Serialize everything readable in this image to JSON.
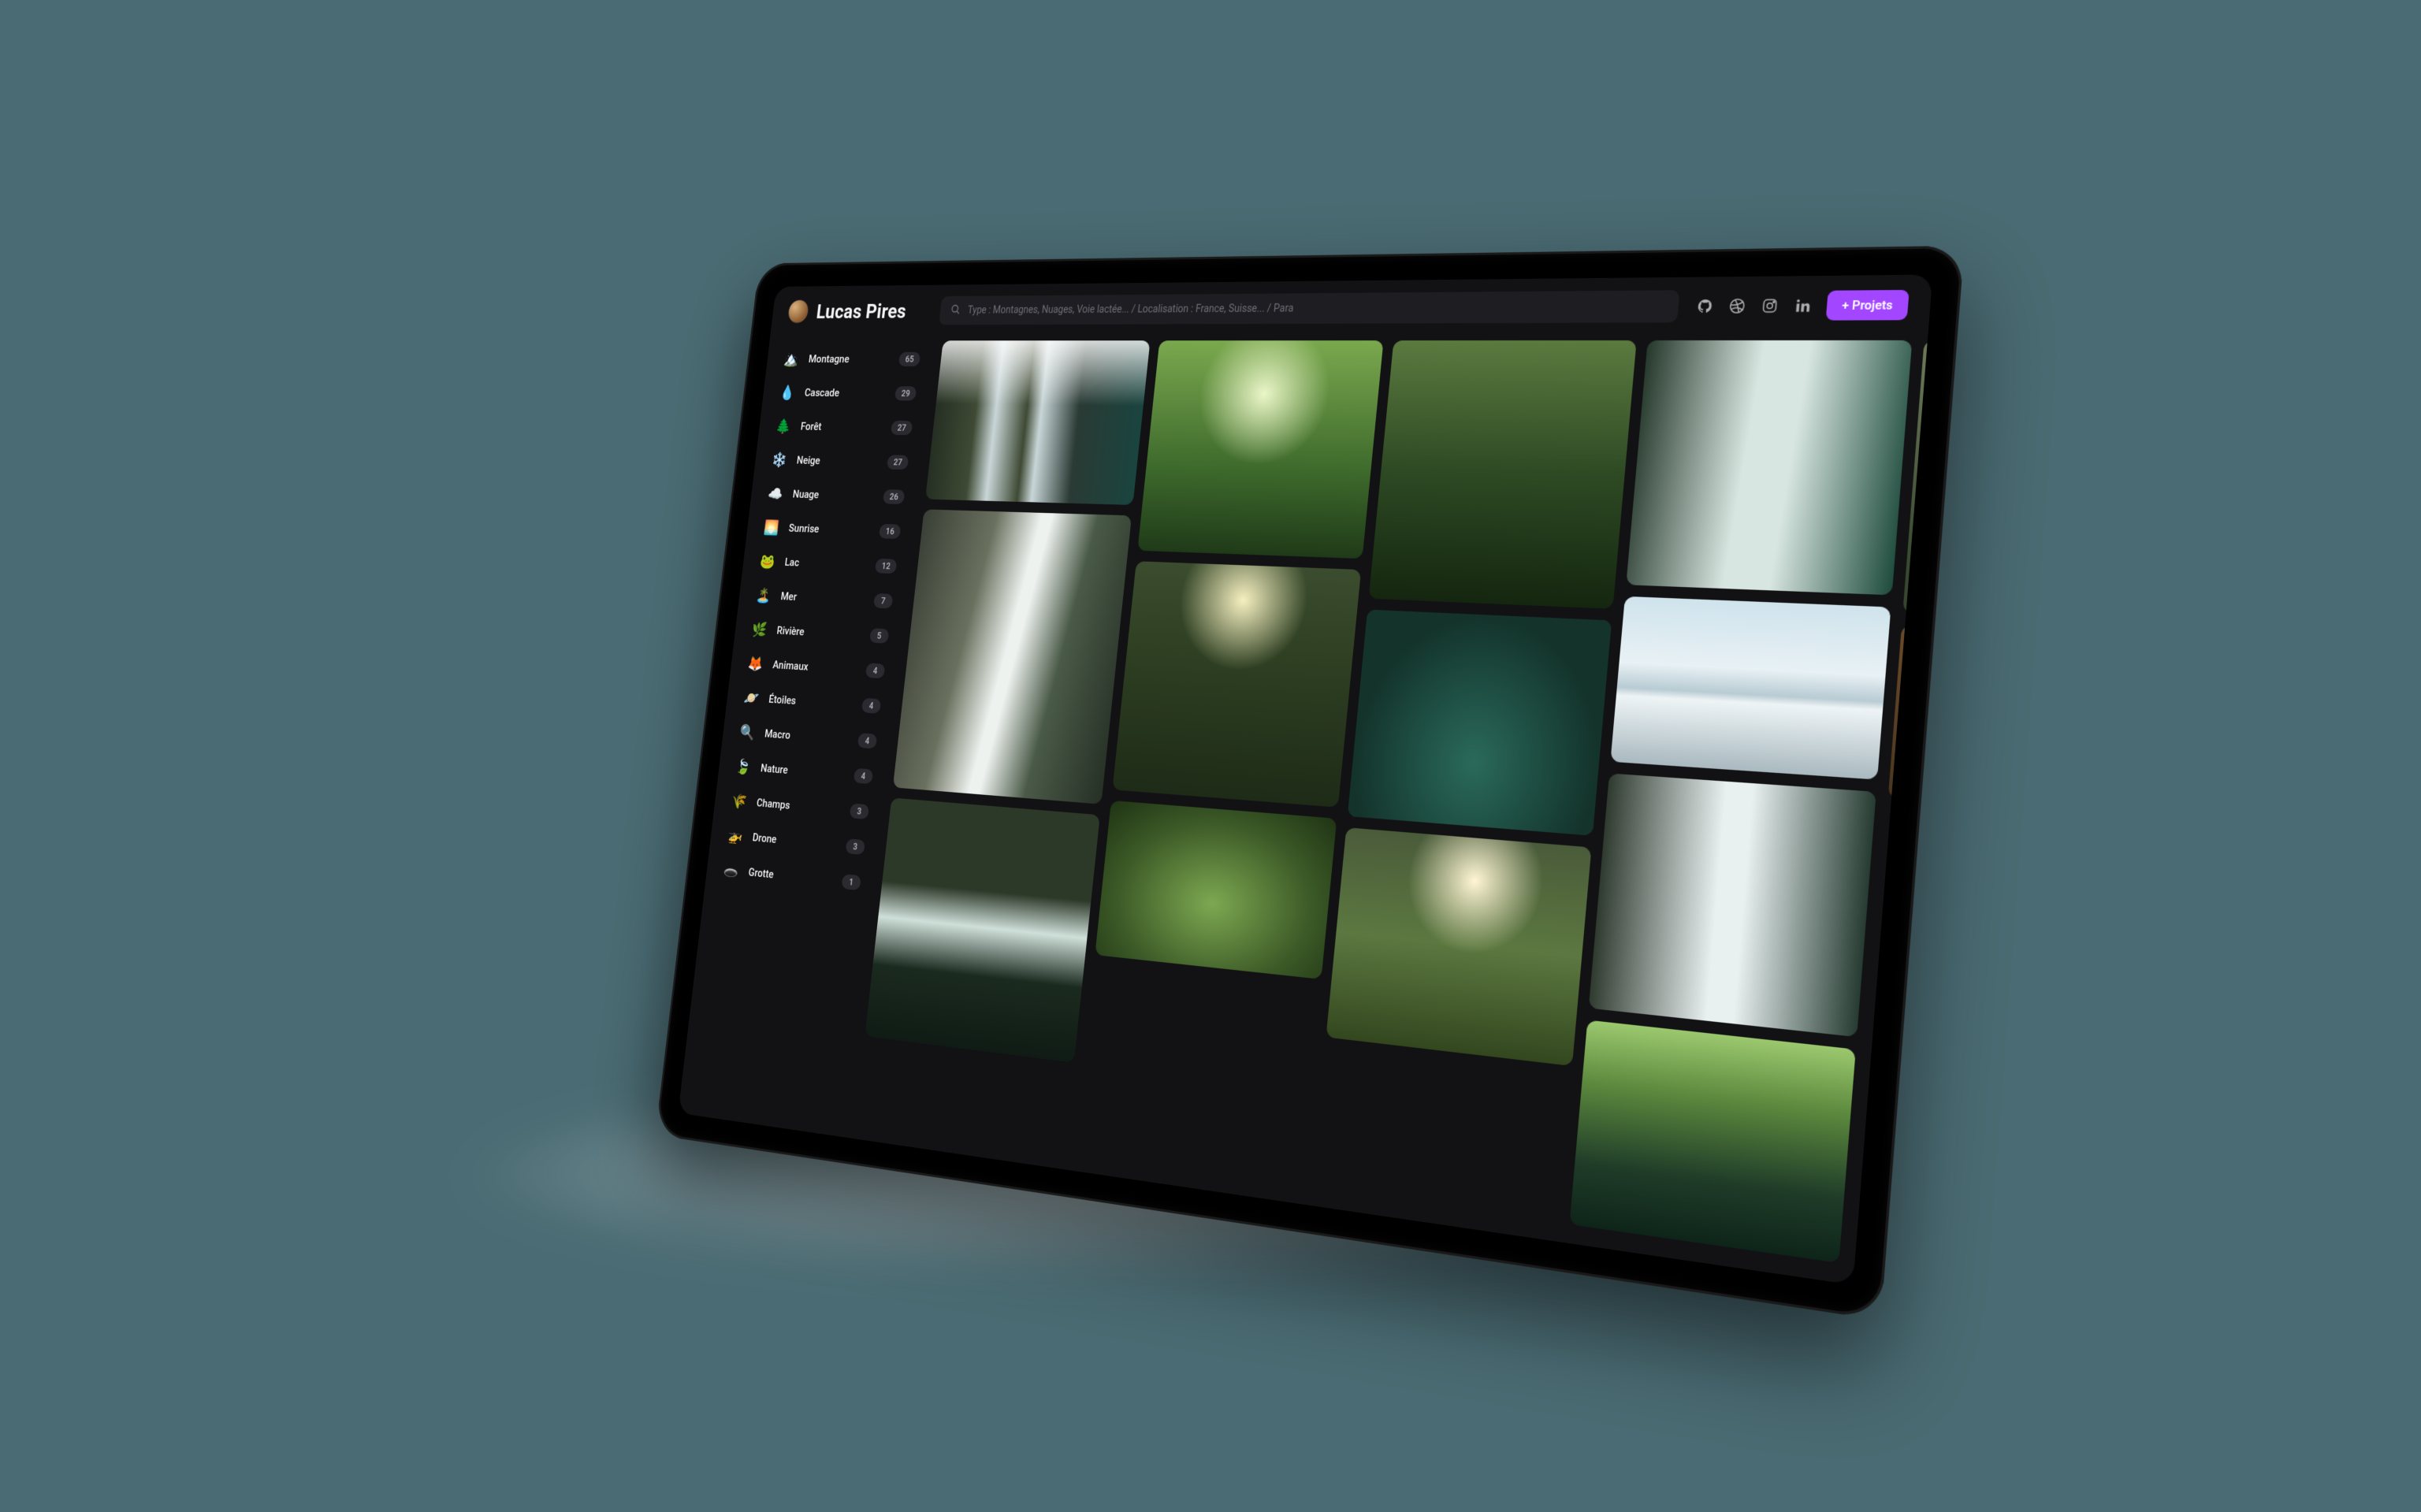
{
  "header": {
    "user_name": "Lucas Pires",
    "search_placeholder": "Type : Montagnes, Nuages, Voie lactée...  /  Localisation : France, Suisse...  /  Para",
    "cta_label": "+ Projets",
    "social_icons": [
      "github",
      "dribbble",
      "instagram",
      "linkedin"
    ]
  },
  "sidebar": {
    "categories": [
      {
        "icon": "🏔️",
        "label": "Montagne",
        "count": 65
      },
      {
        "icon": "💧",
        "label": "Cascade",
        "count": 29
      },
      {
        "icon": "🌲",
        "label": "Forêt",
        "count": 27
      },
      {
        "icon": "❄️",
        "label": "Neige",
        "count": 27
      },
      {
        "icon": "☁️",
        "label": "Nuage",
        "count": 26
      },
      {
        "icon": "🌅",
        "label": "Sunrise",
        "count": 16
      },
      {
        "icon": "🐸",
        "label": "Lac",
        "count": 12
      },
      {
        "icon": "🏝️",
        "label": "Mer",
        "count": 7
      },
      {
        "icon": "🌿",
        "label": "Rivière",
        "count": 5
      },
      {
        "icon": "🦊",
        "label": "Animaux",
        "count": 4
      },
      {
        "icon": "🪐",
        "label": "Étoiles",
        "count": 4
      },
      {
        "icon": "🔍",
        "label": "Macro",
        "count": 4
      },
      {
        "icon": "🍃",
        "label": "Nature",
        "count": 4
      },
      {
        "icon": "🌾",
        "label": "Champs",
        "count": 3
      },
      {
        "icon": "🚁",
        "label": "Drone",
        "count": 3
      },
      {
        "icon": "🕳️",
        "label": "Grotte",
        "count": 1
      }
    ]
  },
  "gallery": {
    "tiles": [
      {
        "name": "waterfall-wide",
        "cls": "t-waterfall-wide"
      },
      {
        "name": "canyon-fall",
        "cls": "t-canyon-fall"
      },
      {
        "name": "gorge",
        "cls": "t-gorge"
      },
      {
        "name": "bright-forest",
        "cls": "t-bright-forest"
      },
      {
        "name": "forest-valley",
        "cls": "t-forest-valley"
      },
      {
        "name": "fern",
        "cls": "t-fern"
      },
      {
        "name": "deep-forest",
        "cls": "t-deep-forest"
      },
      {
        "name": "pool",
        "cls": "t-pool"
      },
      {
        "name": "meadow",
        "cls": "t-meadow"
      },
      {
        "name": "wide-fall",
        "cls": "t-wide-fall"
      },
      {
        "name": "mountain-sky",
        "cls": "t-mountain-sky"
      },
      {
        "name": "tall-fall",
        "cls": "t-tall-fall"
      },
      {
        "name": "moss-stream",
        "cls": "t-moss-stream"
      },
      {
        "name": "rocks",
        "cls": "t-rocks"
      },
      {
        "name": "cabin",
        "cls": "t-cabin"
      }
    ]
  }
}
